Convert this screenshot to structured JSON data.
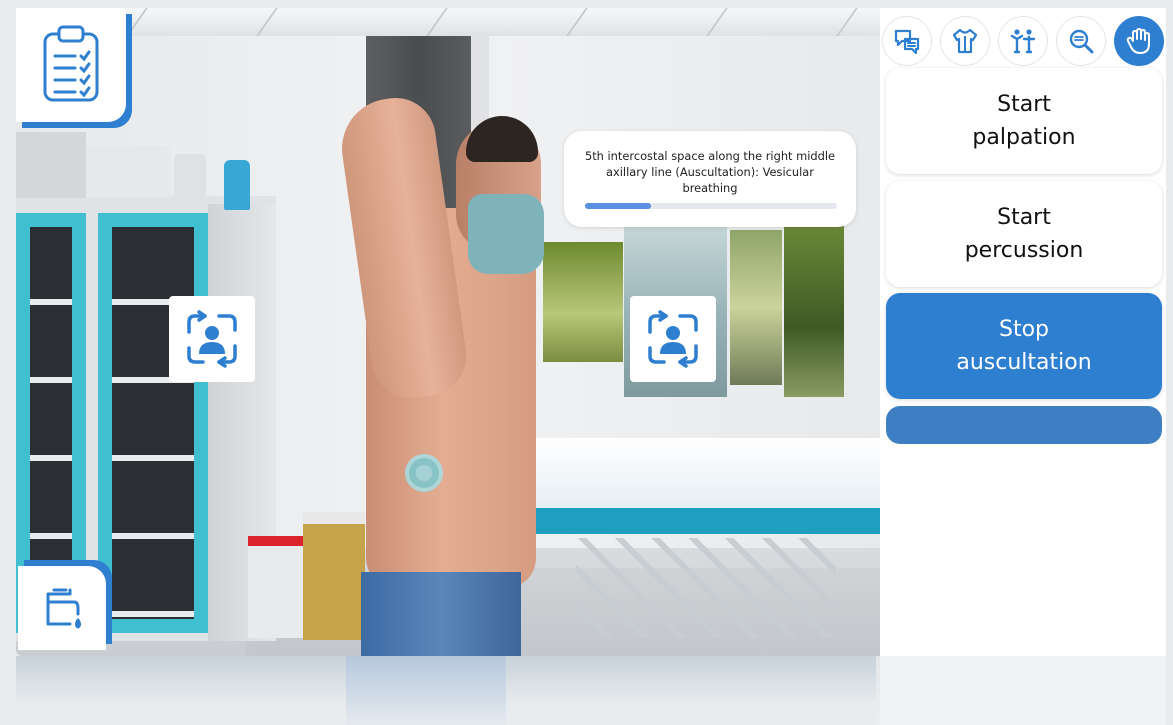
{
  "notification": {
    "text": "5th intercostal space along the right middle axillary line (Auscultation): Vesicular breathing",
    "progress": 0.26
  },
  "toolbar": {
    "tools": [
      {
        "icon": "speech-bubbles-icon",
        "active": false
      },
      {
        "icon": "clothing-icon",
        "active": false
      },
      {
        "icon": "body-pose-icon",
        "active": false
      },
      {
        "icon": "magnifier-icon",
        "active": false
      },
      {
        "icon": "hand-icon",
        "active": true
      }
    ]
  },
  "actions": {
    "palpation": "Start\npalpation",
    "percussion": "Start\npercussion",
    "auscultation": "Stop\nauscultation"
  },
  "colors": {
    "accent": "#2f7fd0",
    "accent_dark": "#3d7fc2",
    "progress": "#5b8fe0"
  },
  "icons": {
    "top_left": "clipboard-checklist-icon",
    "bottom_left": "faucet-handwash-icon",
    "rotate": "rotate-view-person-icon"
  }
}
